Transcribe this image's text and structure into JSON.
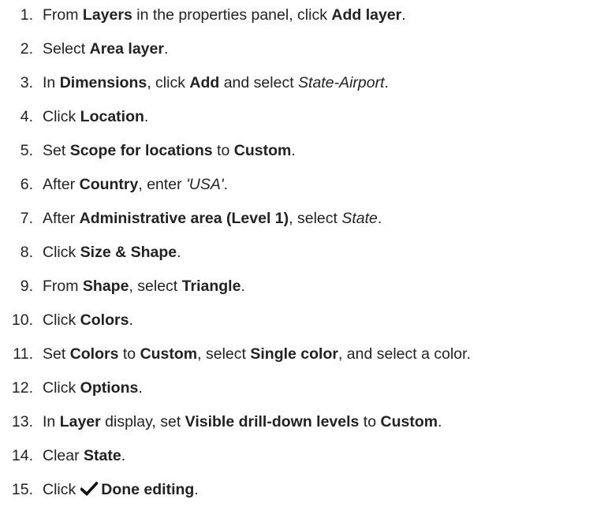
{
  "steps": [
    {
      "num": "1.",
      "parts": [
        {
          "t": "From "
        },
        {
          "t": "Layers",
          "s": "b"
        },
        {
          "t": " in the properties panel, click "
        },
        {
          "t": "Add layer",
          "s": "b"
        },
        {
          "t": "."
        }
      ]
    },
    {
      "num": "2.",
      "parts": [
        {
          "t": "Select "
        },
        {
          "t": "Area layer",
          "s": "b"
        },
        {
          "t": "."
        }
      ]
    },
    {
      "num": "3.",
      "parts": [
        {
          "t": "In "
        },
        {
          "t": "Dimensions",
          "s": "b"
        },
        {
          "t": ", click "
        },
        {
          "t": "Add",
          "s": "b"
        },
        {
          "t": " and select "
        },
        {
          "t": "State-Airport",
          "s": "i"
        },
        {
          "t": "."
        }
      ]
    },
    {
      "num": "4.",
      "parts": [
        {
          "t": "Click "
        },
        {
          "t": "Location",
          "s": "b"
        },
        {
          "t": "."
        }
      ]
    },
    {
      "num": "5.",
      "parts": [
        {
          "t": "Set "
        },
        {
          "t": "Scope for locations",
          "s": "b"
        },
        {
          "t": " to "
        },
        {
          "t": "Custom",
          "s": "b"
        },
        {
          "t": "."
        }
      ]
    },
    {
      "num": "6.",
      "parts": [
        {
          "t": "After "
        },
        {
          "t": "Country",
          "s": "b"
        },
        {
          "t": ", enter "
        },
        {
          "t": "'USA'",
          "s": "i"
        },
        {
          "t": "."
        }
      ]
    },
    {
      "num": "7.",
      "parts": [
        {
          "t": "After "
        },
        {
          "t": "Administrative area (Level 1)",
          "s": "b"
        },
        {
          "t": ", select "
        },
        {
          "t": "State",
          "s": "i"
        },
        {
          "t": "."
        }
      ]
    },
    {
      "num": "8.",
      "parts": [
        {
          "t": "Click "
        },
        {
          "t": "Size & Shape",
          "s": "b"
        },
        {
          "t": "."
        }
      ]
    },
    {
      "num": "9.",
      "parts": [
        {
          "t": "From "
        },
        {
          "t": "Shape",
          "s": "b"
        },
        {
          "t": ", select "
        },
        {
          "t": "Triangle",
          "s": "b"
        },
        {
          "t": "."
        }
      ]
    },
    {
      "num": "10.",
      "parts": [
        {
          "t": "Click "
        },
        {
          "t": "Colors",
          "s": "b"
        },
        {
          "t": "."
        }
      ]
    },
    {
      "num": "11.",
      "parts": [
        {
          "t": "Set "
        },
        {
          "t": "Colors",
          "s": "b"
        },
        {
          "t": " to "
        },
        {
          "t": "Custom",
          "s": "b"
        },
        {
          "t": ", select "
        },
        {
          "t": "Single color",
          "s": "b"
        },
        {
          "t": ", and select a color."
        }
      ]
    },
    {
      "num": "12.",
      "parts": [
        {
          "t": "Click "
        },
        {
          "t": "Options",
          "s": "b"
        },
        {
          "t": "."
        }
      ]
    },
    {
      "num": "13.",
      "parts": [
        {
          "t": "In "
        },
        {
          "t": "Layer",
          "s": "b"
        },
        {
          "t": " display, set "
        },
        {
          "t": "Visible drill-down levels",
          "s": "b"
        },
        {
          "t": " to "
        },
        {
          "t": "Custom",
          "s": "b"
        },
        {
          "t": "."
        }
      ]
    },
    {
      "num": "14.",
      "parts": [
        {
          "t": "Clear "
        },
        {
          "t": "State",
          "s": "b"
        },
        {
          "t": "."
        }
      ]
    },
    {
      "num": "15.",
      "parts": [
        {
          "t": "Click"
        },
        {
          "icon": "check-icon"
        },
        {
          "t": "Done editing",
          "s": "b"
        },
        {
          "t": "."
        }
      ]
    }
  ]
}
